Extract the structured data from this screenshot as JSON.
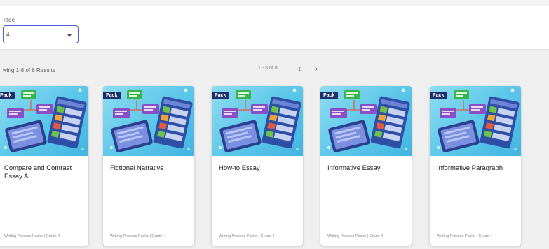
{
  "filters": {
    "grade_label": "rade",
    "grade_value": "4"
  },
  "results": {
    "summary": "wing 1-8 of 8 Results",
    "pager": "1 - 8 of 8",
    "prev_icon": "chevron-left-icon",
    "next_icon": "chevron-right-icon"
  },
  "cards": [
    {
      "badge": "Pack",
      "title": "Compare and Contrast Essay A",
      "meta": "Writing Process Packs | Grade 4"
    },
    {
      "badge": "Pack",
      "title": "Fictional Narrative",
      "meta": "Writing Process Packs | Grade 4"
    },
    {
      "badge": "Pack",
      "title": "How-to Essay",
      "meta": "Writing Process Packs | Grade 4"
    },
    {
      "badge": "Pack",
      "title": "Informative Essay",
      "meta": "Writing Process Packs | Grade 4"
    },
    {
      "badge": "Pack",
      "title": "Informative Paragraph",
      "meta": "Writing Process Packs | Grade 4"
    }
  ],
  "colors": {
    "accent": "#4a63d6",
    "badge": "#1b2f6b",
    "thumbnail": "#5ec8ea"
  }
}
